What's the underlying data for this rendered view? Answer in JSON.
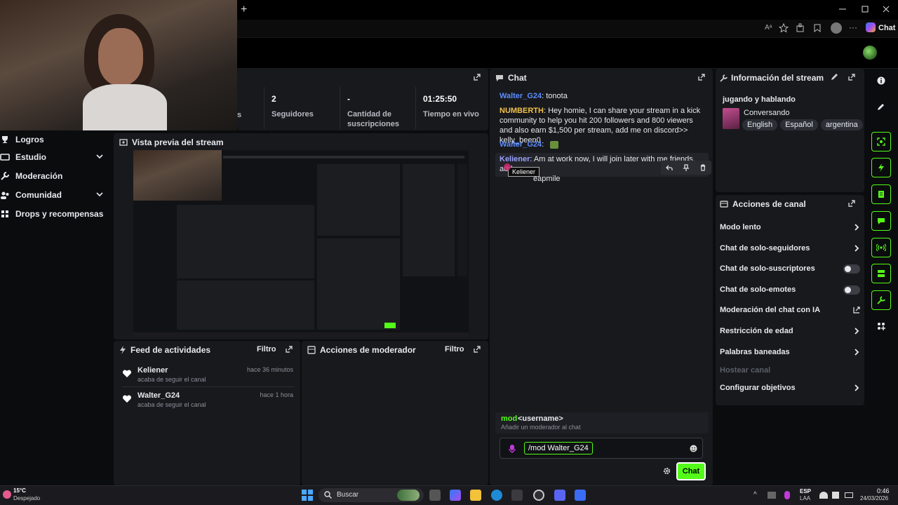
{
  "browser": {
    "new_tab": "+",
    "copilot_label": "Chat",
    "window_controls": [
      "minimize-icon",
      "maximize-icon",
      "close-icon"
    ]
  },
  "sidebar": {
    "items": [
      {
        "label": "Logros",
        "icon": "trophy-icon",
        "chevron": false
      },
      {
        "label": "Estudio",
        "icon": "studio-icon",
        "chevron": true
      },
      {
        "label": "Moderación",
        "icon": "wrench-icon",
        "chevron": false
      },
      {
        "label": "Comunidad",
        "icon": "community-icon",
        "chevron": true
      },
      {
        "label": "Drops y recompensas",
        "icon": "drops-icon",
        "chevron": false
      }
    ]
  },
  "stats": [
    {
      "value": "2",
      "label": "Seguidores"
    },
    {
      "value": "-",
      "label": "Cantidad de suscripciones"
    },
    {
      "value": "01:25:50",
      "label": "Tiempo en vivo"
    }
  ],
  "preview": {
    "title": "Vista previa del stream"
  },
  "activity_feed": {
    "title": "Feed de actividades",
    "filter": "Filtro",
    "items": [
      {
        "user": "Keliener",
        "time": "hace 36 minutos",
        "desc": "acaba de seguir el canal"
      },
      {
        "user": "Walter_G24",
        "time": "hace 1 hora",
        "desc": "acaba de seguir el canal"
      }
    ]
  },
  "mod_actions": {
    "title": "Acciones de moderador",
    "filter": "Filtro"
  },
  "chat": {
    "title": "Chat",
    "messages": [
      {
        "user": "Walter_G24",
        "text": ": tonota"
      },
      {
        "user": "NUMBERTH",
        "text": ": Hey homie, I can share your stream in a kick community to help you hit 200 followers and 800 viewers and also earn $1,500 per stream, add me on discord>> kelly_been0"
      },
      {
        "user": "Walter_G24",
        "text": ":"
      },
      {
        "user": "Keliener",
        "text": ": Am at work now, I will join later with me friends, add me on",
        "text2": "eapmile"
      }
    ],
    "tooltip": "Keliener",
    "suggestion_cmd": "mod",
    "suggestion_arg": "<username>",
    "suggestion_desc": "Añadir un moderador al chat",
    "input_value": "/mod Walter_G24",
    "send_label": "Chat"
  },
  "stream_info": {
    "title": "Información del stream",
    "stream_title": "jugando y hablando",
    "category": "Conversando",
    "tags": [
      "English",
      "Español",
      "argentina"
    ]
  },
  "channel_actions": {
    "title": "Acciones de canal",
    "items": [
      {
        "label": "Modo lento",
        "control": "chevron"
      },
      {
        "label": "Chat de solo-seguidores",
        "control": "chevron"
      },
      {
        "label": "Chat de solo-suscriptores",
        "control": "toggle"
      },
      {
        "label": "Chat de solo-emotes",
        "control": "toggle"
      },
      {
        "label": "Moderación del chat con IA",
        "control": "external"
      },
      {
        "label": "Restricción de edad",
        "control": "chevron"
      },
      {
        "label": "Palabras baneadas",
        "control": "chevron"
      },
      {
        "label": "Hostear canal",
        "control": "none"
      },
      {
        "label": "Configurar objetivos",
        "control": "chevron"
      }
    ]
  },
  "taskbar": {
    "temp": "15°C",
    "weather": "Despejado",
    "search": "Buscar",
    "lang1": "ESP",
    "lang2": "LAA",
    "time": "0:46",
    "date": "24/03/2026"
  },
  "colors": {
    "accent": "#53fc18",
    "panel": "#18191d",
    "username_blue": "#5b8cff",
    "username_yellow": "#f1c24b"
  }
}
